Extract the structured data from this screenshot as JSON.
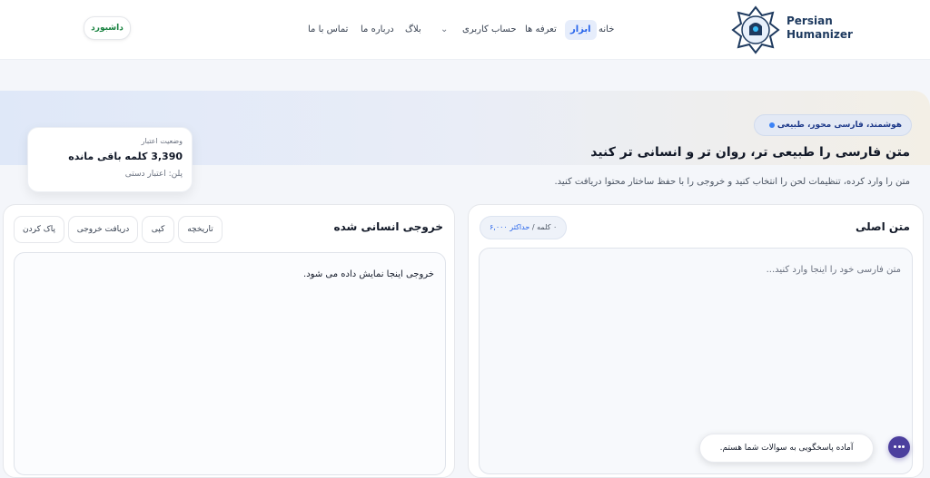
{
  "header": {
    "brand_line1": "Persian",
    "brand_line2": "Humanizer",
    "nav": {
      "home": "خانه",
      "tools": "ابزار",
      "pricing": "تعرفه ها",
      "account": "حساب کاربری",
      "chevron": "⌄",
      "blog": "بلاگ",
      "about": "درباره ما",
      "contact": "تماس با ما"
    },
    "dashboard_button": "داشبورد"
  },
  "hero": {
    "pill": "هوشمند، فارسی محور، طبیعی",
    "title": "متن فارسی را طبیعی تر، روان تر و انسانی تر کنید",
    "subtitle": "متن را وارد کرده، تنظیمات لحن را انتخاب کنید و خروجی را با حفظ ساختار محتوا دریافت کنید."
  },
  "credit": {
    "label": "وضعیت اعتبار",
    "value": "3,390 کلمه باقی مانده",
    "plan": "پلن: اعتبار دستی"
  },
  "input_panel": {
    "title": "متن اصلی",
    "counter_words": "۰ کلمه",
    "counter_sep": " / ",
    "counter_limit": "حداکثر ۶,۰۰۰",
    "placeholder": "متن فارسی خود را اینجا وارد کنید..."
  },
  "output_panel": {
    "title": "خروجی انسانی شده",
    "buttons": {
      "history": "تاریخچه",
      "copy": "کپی",
      "download": "دریافت خروجی",
      "clear": "پاک کردن"
    },
    "placeholder": "خروجی اینجا نمایش داده می شود."
  },
  "chat": {
    "message": "آماده پاسخگویی به سوالات شما هستم."
  },
  "colors": {
    "accent": "#2563eb",
    "dashboard_text": "#15803d",
    "chat_button": "#4c3f9e",
    "brand": "#1e3a5f"
  }
}
